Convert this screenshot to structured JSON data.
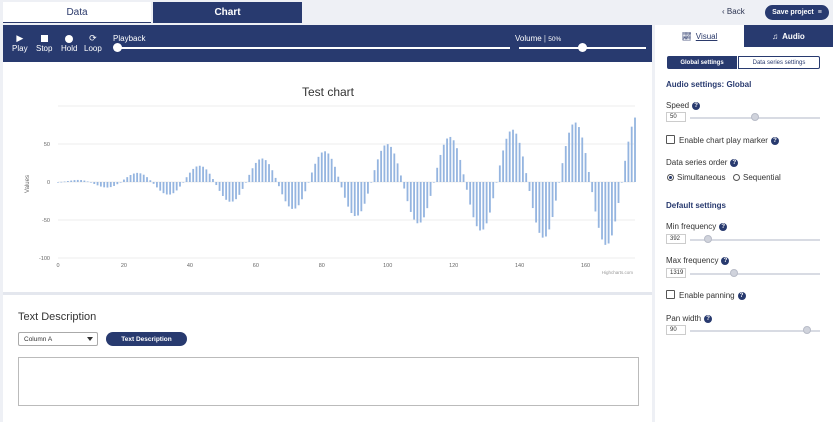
{
  "top_tabs": {
    "data_label": "Data",
    "chart_label": "Chart"
  },
  "header": {
    "back_label": "Back",
    "save_label": "Save project",
    "back_icon": "chevron-left-icon",
    "menu_icon": "hamburger-icon"
  },
  "player": {
    "play_label": "Play",
    "stop_label": "Stop",
    "hold_label": "Hold",
    "loop_label": "Loop",
    "playback_label": "Playback",
    "volume_label": "Volume",
    "volume_value": "50%",
    "playback_position": 0.0,
    "volume_position": 0.5
  },
  "chart_data": {
    "type": "bar",
    "title": "Test chart",
    "xlabel": "",
    "ylabel": "Values",
    "xlim": [
      0,
      175
    ],
    "ylim": [
      -100,
      100
    ],
    "x_ticks": [
      0,
      20,
      40,
      60,
      80,
      100,
      120,
      140,
      160
    ],
    "y_ticks": [
      50,
      0,
      -50,
      -100
    ],
    "credit": "Highcharts.com",
    "color": "#95b5e0",
    "note": "approx values: y = (0.5*x) * sin(2*pi*x/19)",
    "values": []
  },
  "text_description": {
    "title": "Text Description",
    "column_select": "Column A",
    "button_label": "Text Description",
    "content": ""
  },
  "sidebar": {
    "visual_tab": "Visual",
    "audio_tab": "Audio",
    "global_settings": "Global settings",
    "series_settings": "Data series settings",
    "heading": "Audio settings: Global",
    "speed_label": "Speed",
    "speed_value": "50",
    "speed_position": 0.5,
    "play_marker_label": "Enable chart play marker",
    "series_order_label": "Data series order",
    "simultaneous_label": "Simultaneous",
    "sequential_label": "Sequential",
    "default_heading": "Default settings",
    "min_freq_label": "Min frequency",
    "min_freq_value": "392",
    "min_freq_position": 0.14,
    "max_freq_label": "Max frequency",
    "max_freq_value": "1319",
    "max_freq_position": 0.34,
    "panning_label": "Enable panning",
    "pan_width_label": "Pan width",
    "pan_width_value": "90",
    "pan_width_position": 0.9
  }
}
